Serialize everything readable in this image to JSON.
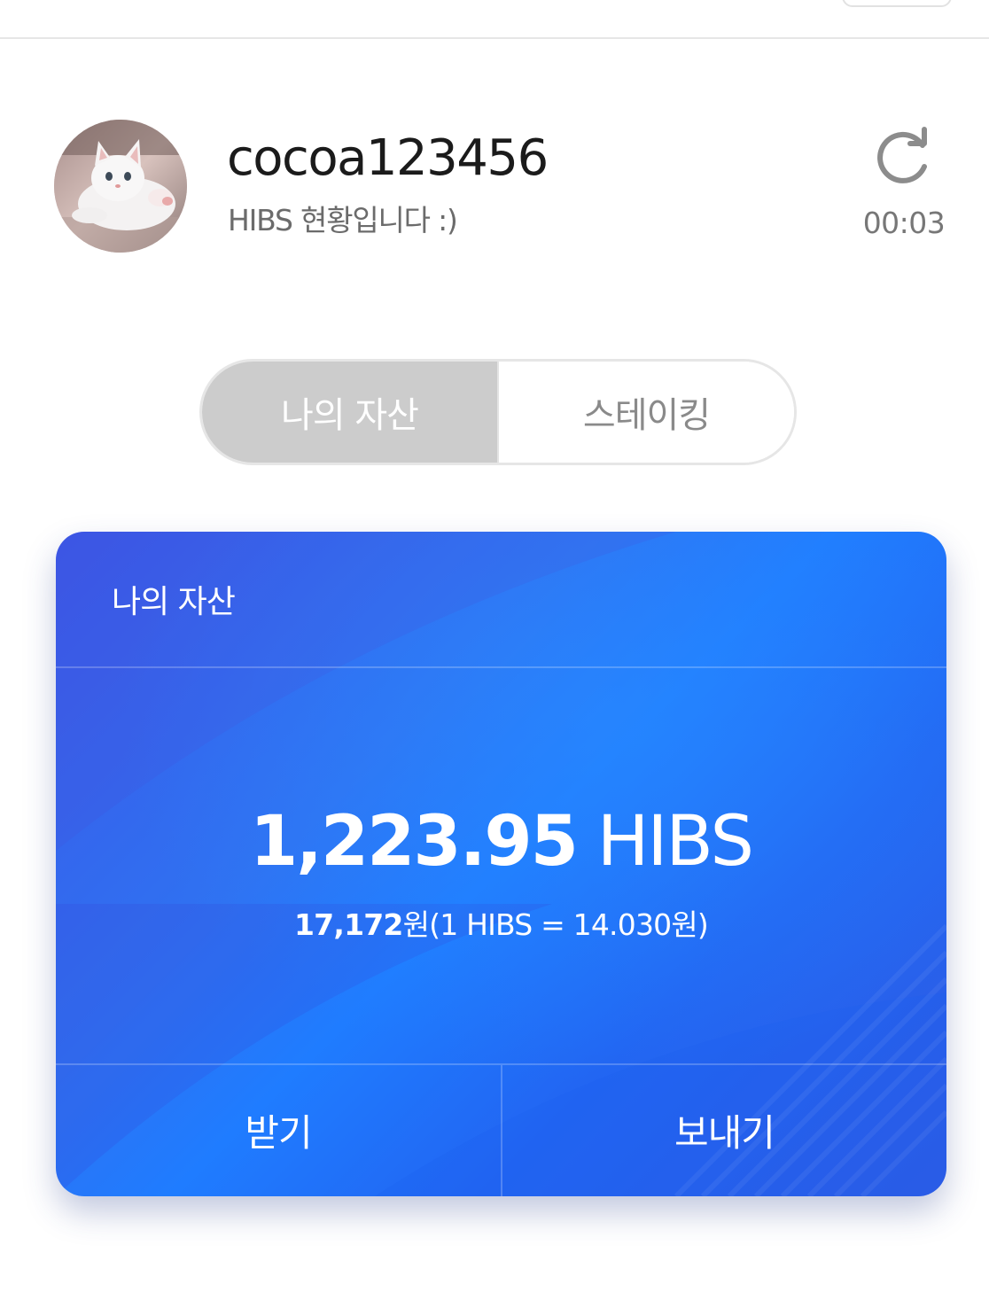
{
  "profile": {
    "avatar_description": "kitten-photo",
    "username": "cocoa123456",
    "subtitle": "HIBS 현황입니다 :)",
    "refresh_icon": "refresh-icon",
    "timer": "00:03"
  },
  "segment": {
    "tabs": [
      {
        "label": "나의 자산",
        "active": true
      },
      {
        "label": "스테이킹",
        "active": false
      }
    ]
  },
  "card": {
    "title": "나의 자산",
    "balance_amount": "1,223.95",
    "balance_unit": "HIBS",
    "fiat_amount": "17,172",
    "fiat_suffix": "원(1 HIBS = 14.030원)",
    "receive_label": "받기",
    "send_label": "보내기"
  },
  "colors": {
    "card_gradient_start": "#3b57e6",
    "card_gradient_mid": "#1f7cff",
    "card_gradient_end": "#2f5ae3",
    "segment_active_bg": "#cccccc",
    "segment_inactive_text": "#8a8a8a"
  }
}
